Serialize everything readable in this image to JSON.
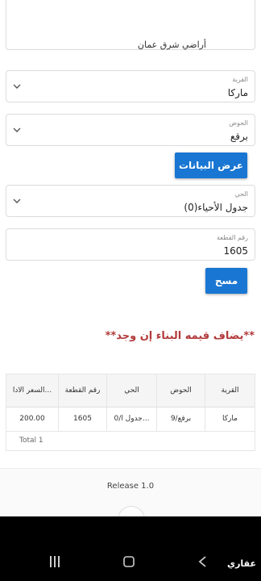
{
  "form": {
    "previous_value": "أراضي شرق عمان",
    "village": {
      "label": "القرية",
      "value": "ماركا"
    },
    "basin": {
      "label": "الحوض",
      "value": "برقع"
    },
    "show_button": "عرض البيانات",
    "neighborhood": {
      "label": "الحي",
      "value": "جدول الأحياء(0)"
    },
    "plot": {
      "label": "رقم القطعة",
      "value": "1605"
    },
    "clear_button": "مسح"
  },
  "note": "**يضاف قيمه البناء إن وجد**",
  "table": {
    "headers": [
      "القرية",
      "الحوض",
      "الحي",
      "رقم القطعة",
      "السعر الادا..."
    ],
    "rows": [
      [
        "ماركا",
        "9/برقع",
        "0/جدول ا...",
        "1605",
        "200.00"
      ]
    ],
    "total": "Total 1"
  },
  "footer": {
    "release": "Release 1.0"
  },
  "nav": {
    "brand": "عقاري",
    "icons": [
      "recents-icon",
      "home-icon",
      "back-icon"
    ]
  }
}
